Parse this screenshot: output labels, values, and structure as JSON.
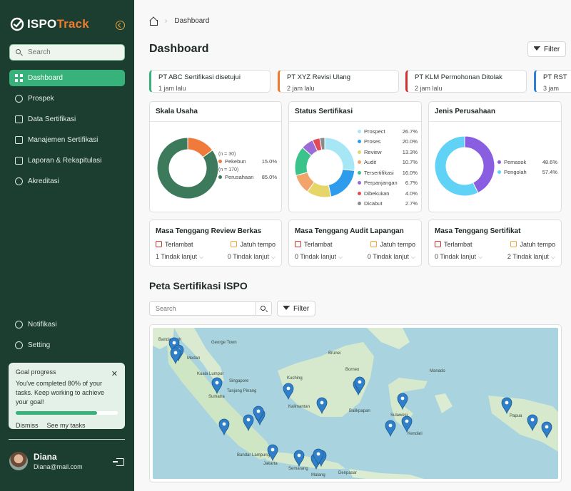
{
  "brand": {
    "name_a": "ISPO",
    "name_b": "Track"
  },
  "search": {
    "placeholder": "Search"
  },
  "nav": [
    {
      "label": "Dashboard",
      "icon": "grid-icon",
      "active": true
    },
    {
      "label": "Prospek",
      "icon": "users-icon"
    },
    {
      "label": "Data Sertifikasi",
      "icon": "database-icon"
    },
    {
      "label": "Manajemen Sertifikasi",
      "icon": "server-icon"
    },
    {
      "label": "Laporan & Rekapitulasi",
      "icon": "clipboard-icon"
    },
    {
      "label": "Akreditasi",
      "icon": "badge-icon"
    }
  ],
  "bottom_nav": [
    {
      "label": "Notifikasi",
      "icon": "bell-icon"
    },
    {
      "label": "Setting",
      "icon": "gear-icon"
    }
  ],
  "goal": {
    "title": "Goal progress",
    "text": "You've completed 80% of your tasks. Keep working to achieve your goal!",
    "progress": 0.8,
    "dismiss": "Dismiss",
    "see": "See my tasks"
  },
  "user": {
    "name": "Diana",
    "email": "Diana@mail.com"
  },
  "breadcrumb": {
    "current": "Dashboard",
    "sep": "›"
  },
  "page": {
    "title": "Dashboard",
    "filter": "Filter"
  },
  "notifications": [
    {
      "title": "PT ABC Sertifikasi disetujui",
      "time": "1 jam lalu",
      "color": "#36b27a"
    },
    {
      "title": "PT XYZ Revisi Ulang",
      "time": "2 jam lalu",
      "color": "#f07a2b"
    },
    {
      "title": "PT KLM Permohonan Ditolak",
      "time": "2 jam lalu",
      "color": "#d0312d"
    },
    {
      "title": "PT RST",
      "time": "3 jam",
      "color": "#2f7fd6"
    }
  ],
  "cards": {
    "skala": {
      "title": "Skala Usaha",
      "items": [
        {
          "note": "(n = 30)",
          "label": "Pekebun",
          "value": "15.0%",
          "pct": 15.0,
          "color": "#f07a3b"
        },
        {
          "note": "(n = 170)",
          "label": "Perusahaan",
          "value": "85.0%",
          "pct": 85.0,
          "color": "#3d7a5c"
        }
      ]
    },
    "status": {
      "title": "Status Sertifikasi",
      "items": [
        {
          "label": "Prospect",
          "value": "26.7%",
          "pct": 26.7,
          "color": "#a7e7f5"
        },
        {
          "label": "Proses",
          "value": "20.0%",
          "pct": 20.0,
          "color": "#2d9cec"
        },
        {
          "label": "Review",
          "value": "13.3%",
          "pct": 13.3,
          "color": "#e6d66a"
        },
        {
          "label": "Audit",
          "value": "10.7%",
          "pct": 10.7,
          "color": "#f2a46a"
        },
        {
          "label": "Tersertifikasi",
          "value": "16.0%",
          "pct": 16.0,
          "color": "#3cc28b"
        },
        {
          "label": "Perpanjangan",
          "value": "6.7%",
          "pct": 6.7,
          "color": "#9b6cd6"
        },
        {
          "label": "Dibekukan",
          "value": "4.0%",
          "pct": 4.0,
          "color": "#e24a5a"
        },
        {
          "label": "Dicabut",
          "value": "2.7%",
          "pct": 2.7,
          "color": "#8a8a8a"
        }
      ]
    },
    "jenis": {
      "title": "Jenis Perusahaan",
      "items": [
        {
          "label": "Pemasok",
          "value": "48.6%",
          "pct": 42.6,
          "color": "#8a5ee0"
        },
        {
          "label": "Pengolah",
          "value": "57.4%",
          "pct": 57.4,
          "color": "#5fd2f5"
        }
      ]
    }
  },
  "grace": [
    {
      "title": "Masa Tenggang Review Berkas",
      "late": "Terlambat",
      "due": "Jatuh tempo",
      "late_action": "1 Tindak lanjut",
      "due_action": "0 Tindak lanjut"
    },
    {
      "title": "Masa Tenggang Audit Lapangan",
      "late": "Terlambat",
      "due": "Jatuh tempo",
      "late_action": "0 Tindak lanjut",
      "due_action": "0 Tindak lanjut"
    },
    {
      "title": "Masa Tenggang Sertifikat",
      "late": "Terlambat",
      "due": "Jatuh tempo",
      "late_action": "0 Tindak lanjut",
      "due_action": "2 Tindak lanjut"
    }
  ],
  "map": {
    "title": "Peta Sertifikasi ISPO",
    "search_placeholder": "Search",
    "filter": "Filter",
    "labels": [
      "Banda Aceh",
      "George Town",
      "Medan",
      "Kuala Lumpur",
      "Singapore",
      "Sumatra",
      "Tanjung Pinang",
      "Kuching",
      "Brunei",
      "Borneo",
      "Kalimantan",
      "Balikpapan",
      "Sulawesi",
      "Kendari",
      "Manado",
      "Bandar Lampung",
      "Jakarta",
      "Semarang",
      "Malang",
      "Denpasar",
      "Papua"
    ]
  }
}
